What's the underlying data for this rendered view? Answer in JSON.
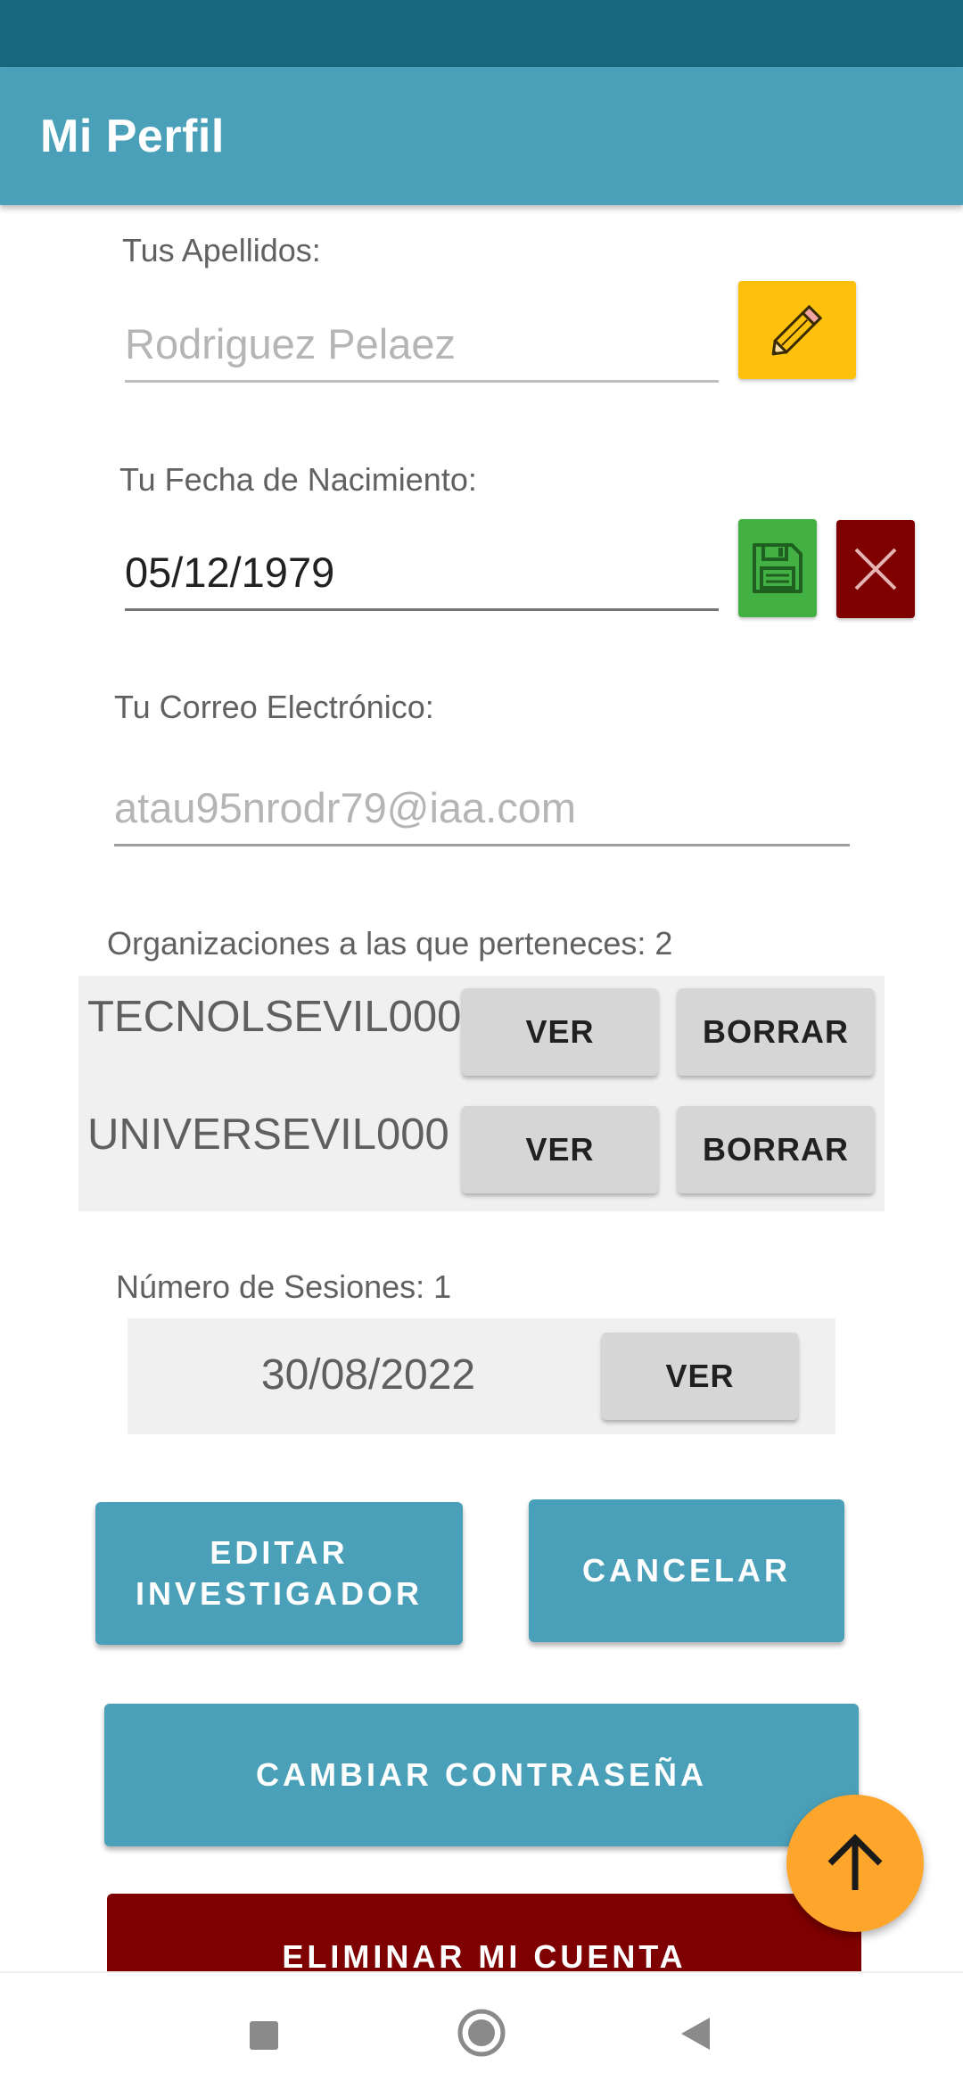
{
  "app": {
    "title": "Mi Perfil"
  },
  "surname": {
    "label": "Tus Apellidos:",
    "value": "Rodriguez Pelaez",
    "edit_icon": "pencil-icon"
  },
  "birthdate": {
    "label": "Tu Fecha de Nacimiento:",
    "value": "05/12/1979",
    "save_icon": "save-icon",
    "cancel_icon": "close-icon"
  },
  "email": {
    "label": "Tu Correo Electrónico:",
    "value": "atau95nrodr79@iaa.com"
  },
  "organizations": {
    "label": "Organizaciones a las que perteneces: 2",
    "items": [
      {
        "name": "TECNOLSEVIL000",
        "view_label": "VER",
        "delete_label": "BORRAR"
      },
      {
        "name": "UNIVERSEVIL000",
        "view_label": "VER",
        "delete_label": "BORRAR"
      }
    ]
  },
  "sessions": {
    "label": "Número de Sesiones: 1",
    "items": [
      {
        "date": "30/08/2022",
        "view_label": "VER"
      }
    ]
  },
  "actions": {
    "edit_line1": "EDITAR",
    "edit_line2": "INVESTIGADOR",
    "cancel_label": "CANCELAR",
    "change_password_label": "CAMBIAR CONTRASEÑA",
    "delete_account_label": "ELIMINAR MI CUENTA"
  },
  "colors": {
    "primary": "#4aa0b8",
    "status_bar": "#17687c",
    "edit_button": "#fdc10d",
    "save_button": "#43b043",
    "danger": "#7f0000",
    "fab": "#fea52b"
  },
  "fab": {
    "icon": "arrow-up-icon"
  },
  "nav": {
    "icons": [
      "recents-square-icon",
      "home-circle-icon",
      "back-triangle-icon"
    ]
  }
}
